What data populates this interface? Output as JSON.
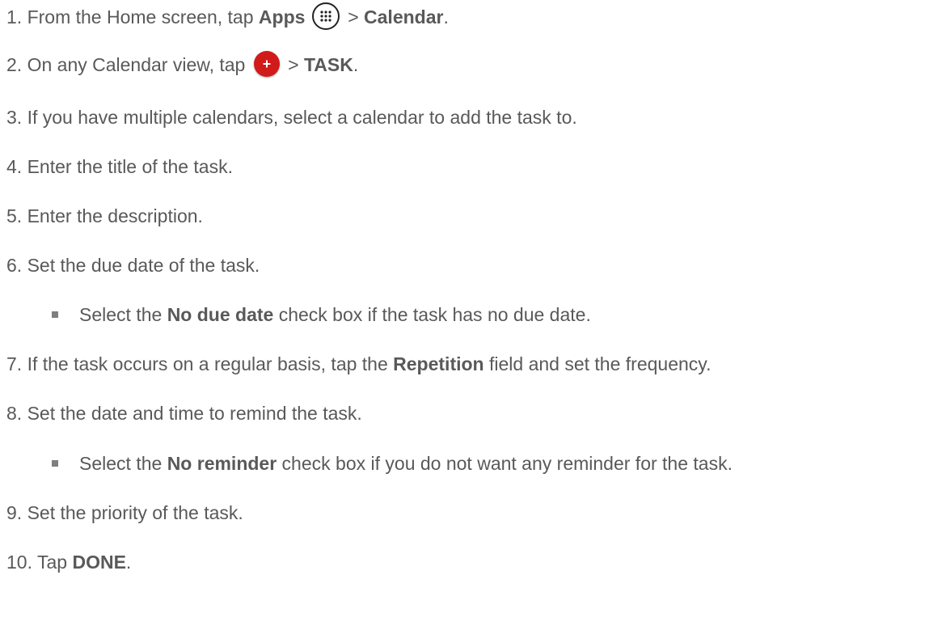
{
  "steps": {
    "s1": {
      "num": "1.",
      "pre": "From the Home screen, tap ",
      "apps": "Apps",
      "sep": " > ",
      "calendar": "Calendar",
      "end": "."
    },
    "s2": {
      "num": "2.",
      "pre": "On any Calendar view, tap ",
      "sep": " > ",
      "task": "TASK",
      "end": "."
    },
    "s3": {
      "num": "3.",
      "text": "If you have multiple calendars, select a calendar to add the task to."
    },
    "s4": {
      "num": "4.",
      "text": "Enter the title of the task."
    },
    "s5": {
      "num": "5.",
      "text": "Enter the description."
    },
    "s6": {
      "num": "6.",
      "text": "Set the due date of the task."
    },
    "s6b": {
      "pre": "Select the ",
      "bold": "No due date",
      "post": " check box if the task has no due date."
    },
    "s7": {
      "num": "7.",
      "pre": "If the task occurs on a regular basis, tap the ",
      "bold": "Repetition",
      "post": " field and set the frequency."
    },
    "s8": {
      "num": "8.",
      "text": "Set the date and time to remind the task."
    },
    "s8b": {
      "pre": "Select the ",
      "bold": "No reminder",
      "post": " check box if you do not want any reminder for the task."
    },
    "s9": {
      "num": "9.",
      "text": "Set the priority of the task."
    },
    "s10": {
      "num": "10.",
      "pre": "Tap ",
      "bold": "DONE",
      "end": "."
    }
  },
  "icons": {
    "apps": "apps-grid-icon",
    "add": "add-plus-icon",
    "add_color": "#d11a1a",
    "bullet": "square-bullet-icon"
  }
}
